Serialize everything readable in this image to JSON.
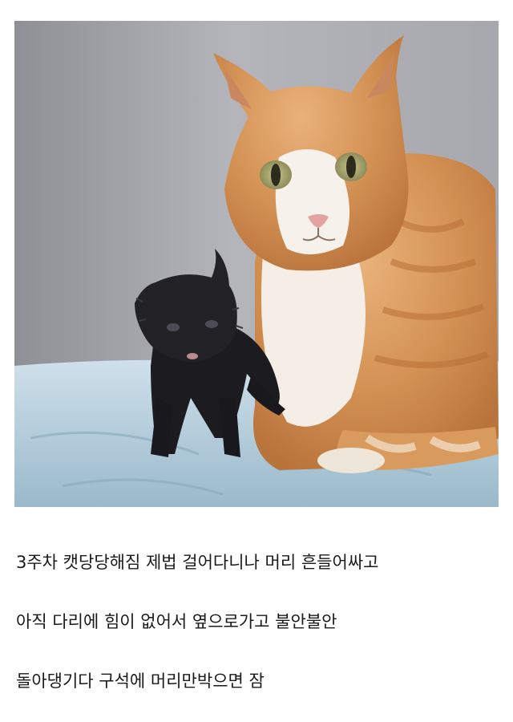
{
  "caption": {
    "lines": [
      "3주차 캣당당해짐 제법 걸어다니나 머리 흔들어싸고",
      "아직 다리에 힘이 없어서 옆으로가고 불안불안",
      "돌아댕기다 구석에 머리만박으면 잠"
    ]
  }
}
